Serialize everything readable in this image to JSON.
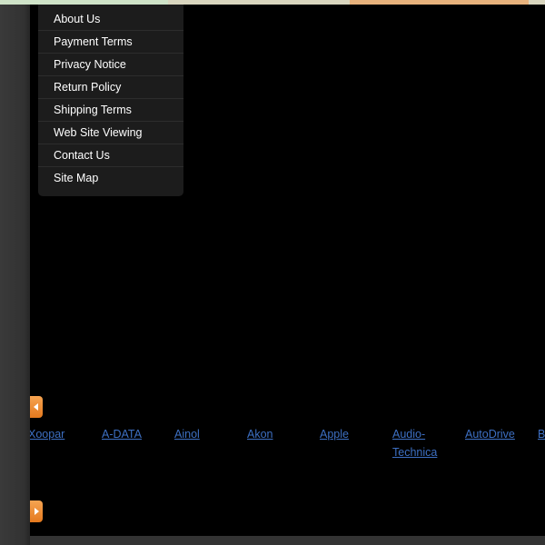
{
  "menu": {
    "items": [
      {
        "label": "About Us"
      },
      {
        "label": "Payment Terms"
      },
      {
        "label": "Privacy Notice"
      },
      {
        "label": "Return Policy"
      },
      {
        "label": "Shipping Terms"
      },
      {
        "label": "Web Site Viewing"
      },
      {
        "label": "Contact Us"
      },
      {
        "label": "Site Map"
      }
    ]
  },
  "carousel": {
    "prev_icon": "arrow-left-icon",
    "next_icon": "arrow-right-icon",
    "accent_color": "#e4791e",
    "brands": [
      {
        "label": "Xoopar"
      },
      {
        "label": "A-DATA"
      },
      {
        "label": "Ainol"
      },
      {
        "label": "Akon"
      },
      {
        "label": "Apple"
      },
      {
        "label": "Audio-Technica"
      },
      {
        "label": "AutoDrive"
      },
      {
        "label": "B"
      }
    ]
  },
  "colors": {
    "link": "#3d6fc2",
    "background": "#000000",
    "menu_background": "#1c1c1c"
  }
}
